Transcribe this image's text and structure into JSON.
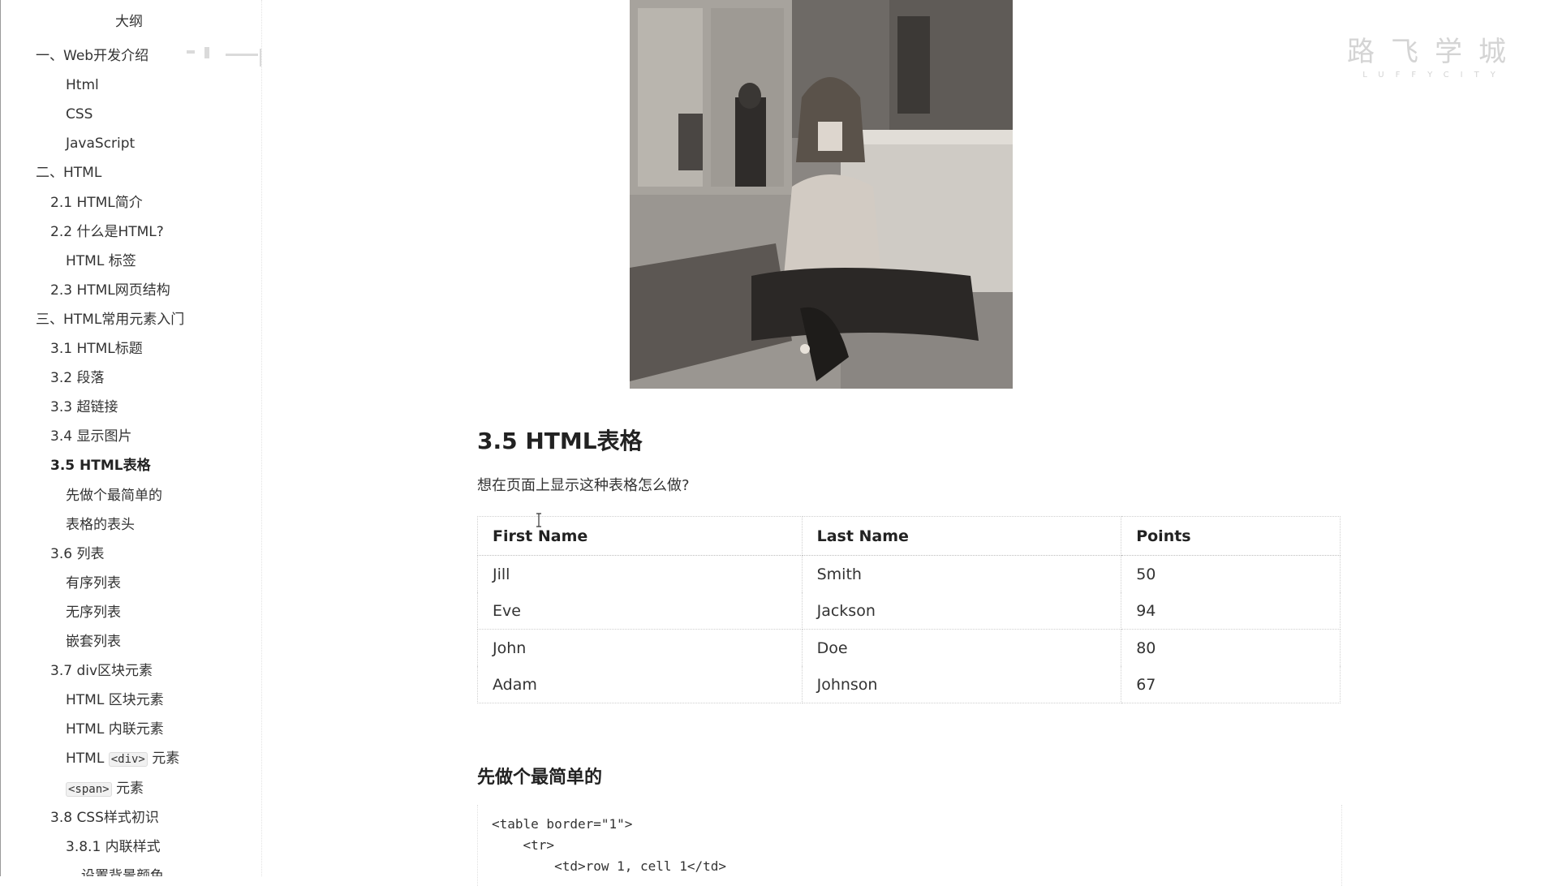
{
  "sidebar": {
    "title": "大纲",
    "items": [
      {
        "label": "一、Web开发介绍",
        "level": 1,
        "active": false
      },
      {
        "label": "Html",
        "level": 3,
        "active": false
      },
      {
        "label": "CSS",
        "level": 3,
        "active": false
      },
      {
        "label": "JavaScript",
        "level": 3,
        "active": false
      },
      {
        "label": "二、HTML",
        "level": 1,
        "active": false
      },
      {
        "label": "2.1 HTML简介",
        "level": 2,
        "active": false
      },
      {
        "label": "2.2 什么是HTML?",
        "level": 2,
        "active": false
      },
      {
        "label": "HTML 标签",
        "level": 3,
        "active": false
      },
      {
        "label": "2.3 HTML网页结构",
        "level": 2,
        "active": false
      },
      {
        "label": "三、HTML常用元素入门",
        "level": 1,
        "active": false
      },
      {
        "label": "3.1 HTML标题",
        "level": 2,
        "active": false
      },
      {
        "label": "3.2 段落",
        "level": 2,
        "active": false
      },
      {
        "label": "3.3 超链接",
        "level": 2,
        "active": false
      },
      {
        "label": "3.4 显示图片",
        "level": 2,
        "active": false
      },
      {
        "label": "3.5 HTML表格",
        "level": 2,
        "active": true
      },
      {
        "label": "先做个最简单的",
        "level": 3,
        "active": false
      },
      {
        "label": "表格的表头",
        "level": 3,
        "active": false
      },
      {
        "label": "3.6 列表",
        "level": 2,
        "active": false
      },
      {
        "label": "有序列表",
        "level": 3,
        "active": false
      },
      {
        "label": "无序列表",
        "level": 3,
        "active": false
      },
      {
        "label": "嵌套列表",
        "level": 3,
        "active": false
      },
      {
        "label": "3.7 div区块元素",
        "level": 2,
        "active": false
      },
      {
        "label": "HTML 区块元素",
        "level": 3,
        "active": false
      },
      {
        "label": "HTML 内联元素",
        "level": 3,
        "active": false
      },
      {
        "label": "HTML ",
        "code": "<div>",
        "suffix": " 元素",
        "level": 3,
        "active": false
      },
      {
        "label": "",
        "code": "<span>",
        "suffix": " 元素",
        "level": 3,
        "active": false
      },
      {
        "label": "3.8 CSS样式初识",
        "level": 2,
        "active": false
      },
      {
        "label": "3.8.1 内联样式",
        "level": 3,
        "active": false
      },
      {
        "label": "设置背景颜色",
        "level": 4,
        "active": false
      }
    ]
  },
  "watermark": {
    "cn": "路飞学城",
    "en": "LUFFYCITY"
  },
  "main": {
    "heading": "3.5 HTML表格",
    "question": "想在页面上显示这种表格怎么做?",
    "table": {
      "headers": [
        "First Name",
        "Last Name",
        "Points"
      ],
      "rows": [
        [
          "Jill",
          "Smith",
          "50"
        ],
        [
          "Eve",
          "Jackson",
          "94"
        ],
        [
          "John",
          "Doe",
          "80"
        ],
        [
          "Adam",
          "Johnson",
          "67"
        ]
      ]
    },
    "subheading": "先做个最简单的",
    "code_lines": [
      "<table border=\"1\">",
      "    <tr>",
      "        <td>row 1, cell 1</td>"
    ]
  },
  "colors": {
    "text": "#333333",
    "heading": "#222222",
    "watermark": "#d4d4d4",
    "photo_bg": "#7b7874"
  }
}
